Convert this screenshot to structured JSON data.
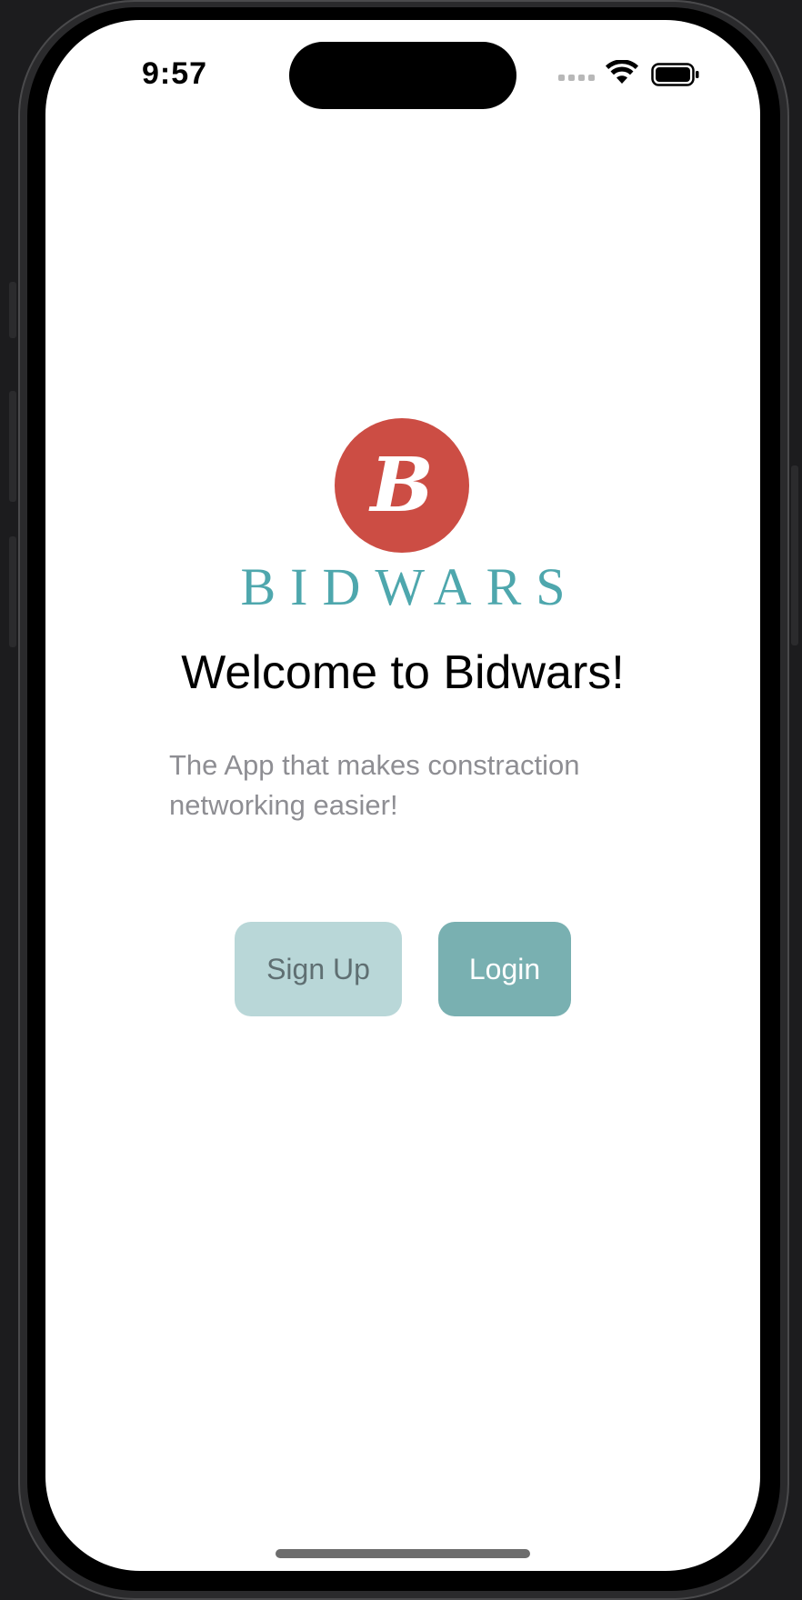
{
  "status_bar": {
    "time": "9:57",
    "signal_icon": "cellular-signal-icon",
    "wifi_icon": "wifi-icon",
    "battery_icon": "battery-icon"
  },
  "logo": {
    "monogram": "B",
    "wordmark": "BIDWARS",
    "circle_color": "#cc4d44",
    "wordmark_color": "#4ea7ad"
  },
  "welcome": {
    "title": "Welcome to Bidwars!",
    "subtitle": "The App that makes constraction networking easier!"
  },
  "actions": {
    "signup_label": "Sign Up",
    "login_label": "Login",
    "signup_color": "#b9d7d8",
    "login_color": "#79b0b1"
  }
}
